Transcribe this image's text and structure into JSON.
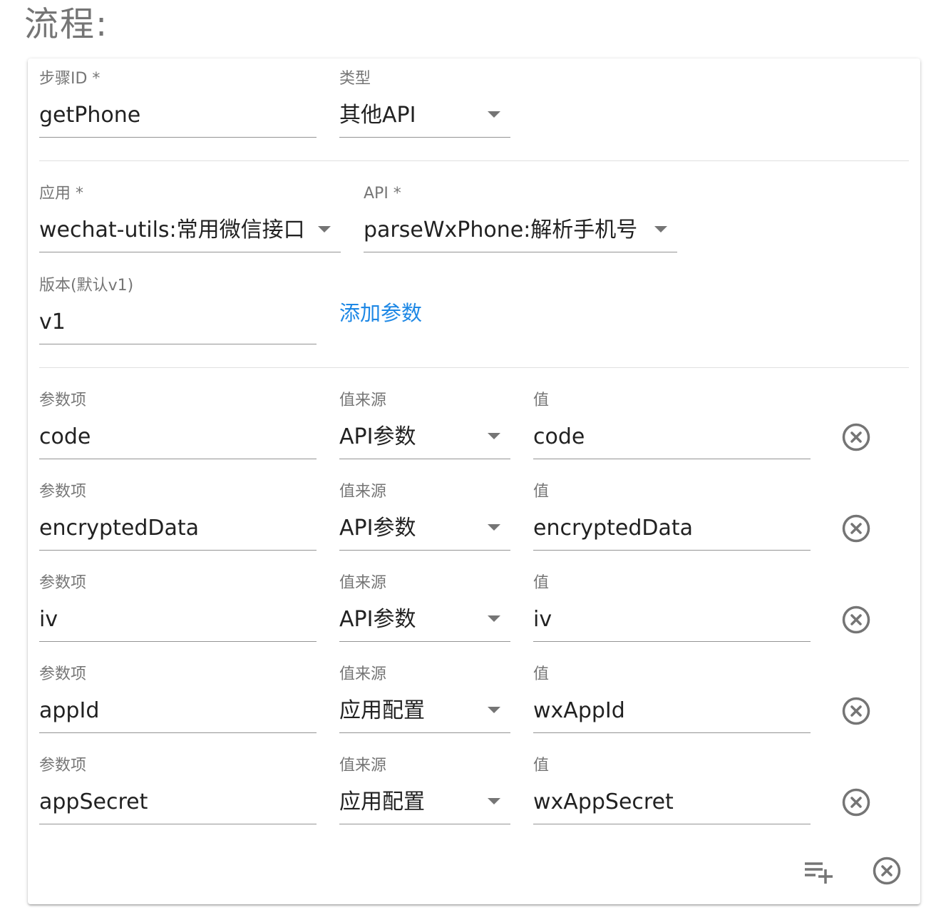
{
  "page_title": "流程:",
  "step": {
    "id_label": "步骤ID *",
    "id_value": "getPhone",
    "type_label": "类型",
    "type_value": "其他API"
  },
  "api_config": {
    "app_label": "应用 *",
    "app_value": "wechat-utils:常用微信接口",
    "api_label": "API *",
    "api_value": "parseWxPhone:解析手机号",
    "version_label": "版本(默认v1)",
    "version_value": "v1",
    "add_param_label": "添加参数"
  },
  "params": [
    {
      "name_label": "参数项",
      "name": "code",
      "source_label": "值来源",
      "source": "API参数",
      "value_label": "值",
      "value": "code"
    },
    {
      "name_label": "参数项",
      "name": "encryptedData",
      "source_label": "值来源",
      "source": "API参数",
      "value_label": "值",
      "value": "encryptedData"
    },
    {
      "name_label": "参数项",
      "name": "iv",
      "source_label": "值来源",
      "source": "API参数",
      "value_label": "值",
      "value": "iv"
    },
    {
      "name_label": "参数项",
      "name": "appId",
      "source_label": "值来源",
      "source": "应用配置",
      "value_label": "值",
      "value": "wxAppId"
    },
    {
      "name_label": "参数项",
      "name": "appSecret",
      "source_label": "值来源",
      "source": "应用配置",
      "value_label": "值",
      "value": "wxAppSecret"
    }
  ],
  "footer_icons": [
    "playlist-add-icon",
    "remove-step-icon"
  ],
  "colors": {
    "link": "#1e88e5",
    "icon": "#757575"
  }
}
